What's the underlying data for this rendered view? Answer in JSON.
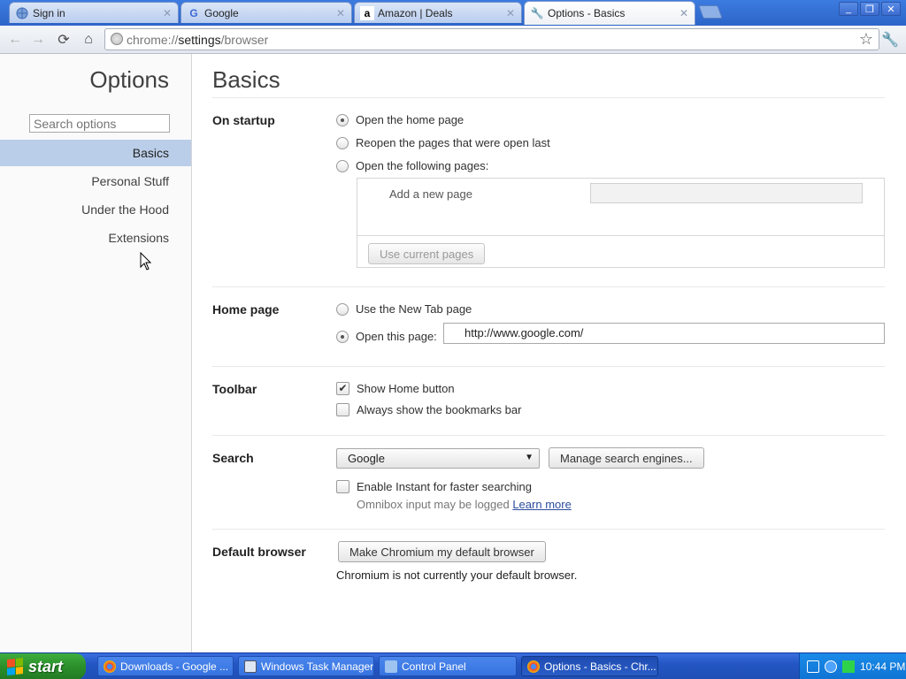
{
  "tabs": [
    {
      "title": "Sign in",
      "favicon": "globe-icon"
    },
    {
      "title": "Google",
      "favicon": "google-icon"
    },
    {
      "title": "Amazon | Deals",
      "favicon": "amazon-icon"
    },
    {
      "title": "Options - Basics",
      "favicon": "wrench-icon",
      "active": true
    }
  ],
  "toolbar": {
    "url_scheme": "chrome://",
    "url_path": "settings",
    "url_rest": "/browser"
  },
  "sidebar": {
    "title": "Options",
    "search_placeholder": "Search options",
    "items": [
      {
        "label": "Basics",
        "selected": true
      },
      {
        "label": "Personal Stuff"
      },
      {
        "label": "Under the Hood"
      },
      {
        "label": "Extensions"
      }
    ]
  },
  "main": {
    "title": "Basics",
    "startup": {
      "label": "On startup",
      "options": [
        "Open the home page",
        "Reopen the pages that were open last",
        "Open the following pages:"
      ],
      "selected_index": 0,
      "add_page_label": "Add a new page",
      "use_current_label": "Use current pages"
    },
    "homepage": {
      "label": "Home page",
      "option_newtab": "Use the New Tab page",
      "option_this": "Open this page:",
      "url_value": "http://www.google.com/"
    },
    "toolbar_section": {
      "label": "Toolbar",
      "show_home": "Show Home button",
      "show_home_checked": true,
      "bookmarks_bar": "Always show the bookmarks bar",
      "bookmarks_bar_checked": false
    },
    "search": {
      "label": "Search",
      "engine": "Google",
      "manage_label": "Manage search engines...",
      "instant_label": "Enable Instant for faster searching",
      "instant_checked": false,
      "hint_text": "Omnibox input may be logged ",
      "learn_more": "Learn more"
    },
    "default_browser": {
      "label": "Default browser",
      "button_label": "Make Chromium my default browser",
      "status": "Chromium is not currently your default browser."
    }
  },
  "taskbar": {
    "start_label": "start",
    "tasks": [
      {
        "label": "Downloads - Google ..."
      },
      {
        "label": "Windows Task Manager"
      },
      {
        "label": "Control Panel"
      },
      {
        "label": "Options - Basics - Chr...",
        "active": true
      }
    ],
    "clock": "10:44 PM"
  },
  "colors": {
    "sidebar_selected": "#bbcee9",
    "link": "#2a4d9e",
    "taskbar": "#2456c4",
    "start_button": "#2a8f2a"
  }
}
